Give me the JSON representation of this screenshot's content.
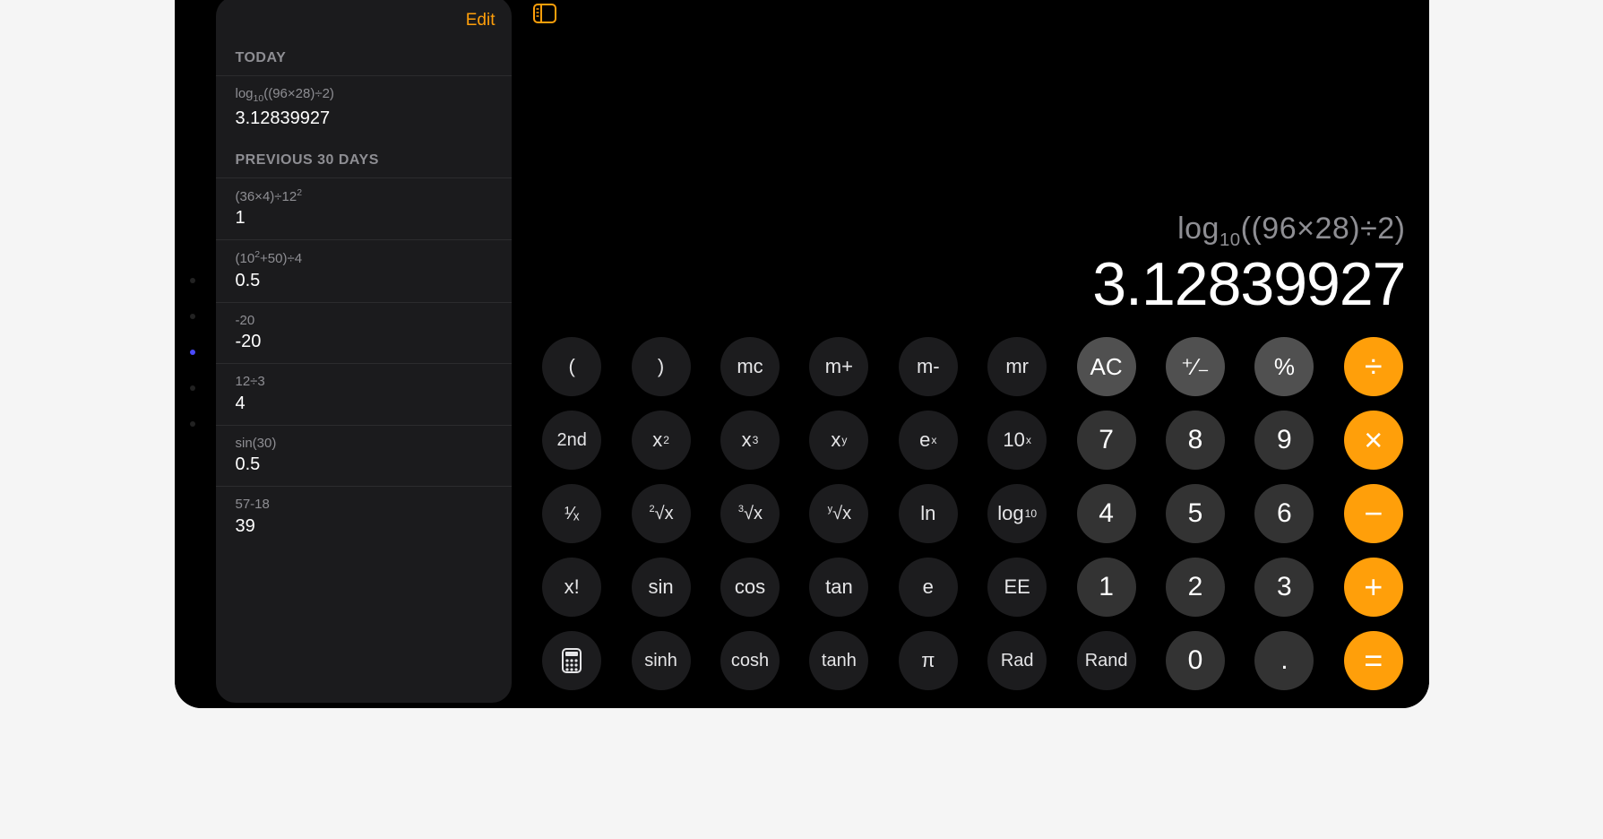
{
  "sidebar": {
    "edit_label": "Edit",
    "sections": [
      {
        "title": "TODAY",
        "items": [
          {
            "expr_html": "log<sub>10</sub>((96×28)÷2)",
            "result": "3.12839927"
          }
        ]
      },
      {
        "title": "PREVIOUS 30 DAYS",
        "items": [
          {
            "expr_html": "(36×4)÷12<sup>2</sup>",
            "result": "1"
          },
          {
            "expr_html": "(10<sup>2</sup>+50)÷4",
            "result": "0.5"
          },
          {
            "expr_html": "-20",
            "result": "-20"
          },
          {
            "expr_html": "12÷3",
            "result": "4"
          },
          {
            "expr_html": "sin(30)",
            "result": "0.5"
          },
          {
            "expr_html": "57-18",
            "result": "39"
          }
        ]
      }
    ]
  },
  "display": {
    "expression_html": "log<sub>10</sub>((96×28)÷2)",
    "result": "3.12839927"
  },
  "keys": {
    "row0": [
      {
        "name": "lparen",
        "cls": "dark",
        "html": "("
      },
      {
        "name": "rparen",
        "cls": "dark",
        "html": ")"
      },
      {
        "name": "mc",
        "cls": "dark",
        "html": "mc"
      },
      {
        "name": "mplus",
        "cls": "dark",
        "html": "m+"
      },
      {
        "name": "mminus",
        "cls": "dark",
        "html": "m-"
      },
      {
        "name": "mr",
        "cls": "dark",
        "html": "mr"
      },
      {
        "name": "ac",
        "cls": "gray",
        "html": "AC"
      },
      {
        "name": "negate",
        "cls": "gray",
        "html": "⁺∕₋"
      },
      {
        "name": "percent",
        "cls": "gray",
        "html": "%"
      },
      {
        "name": "divide",
        "cls": "op",
        "html": "÷"
      }
    ],
    "row1": [
      {
        "name": "second",
        "cls": "dark small",
        "html": "2nd"
      },
      {
        "name": "xsq",
        "cls": "dark",
        "html": "x<sup>2</sup>"
      },
      {
        "name": "xcb",
        "cls": "dark",
        "html": "x<sup>3</sup>"
      },
      {
        "name": "xy",
        "cls": "dark",
        "html": "x<sup>y</sup>"
      },
      {
        "name": "ex",
        "cls": "dark",
        "html": "e<sup>x</sup>"
      },
      {
        "name": "tenx",
        "cls": "dark",
        "html": "10<sup>x</sup>"
      },
      {
        "name": "seven",
        "cls": "num",
        "html": "7"
      },
      {
        "name": "eight",
        "cls": "num",
        "html": "8"
      },
      {
        "name": "nine",
        "cls": "num",
        "html": "9"
      },
      {
        "name": "multiply",
        "cls": "op",
        "html": "×"
      }
    ],
    "row2": [
      {
        "name": "recip",
        "cls": "dark",
        "html": "<span class='frac'>¹⁄ₓ</span>"
      },
      {
        "name": "sqrt",
        "cls": "dark",
        "html": "<span class='root'><sup>2</sup>√x</span>"
      },
      {
        "name": "cbrt",
        "cls": "dark",
        "html": "<span class='root'><sup>3</sup>√x</span>"
      },
      {
        "name": "yroot",
        "cls": "dark",
        "html": "<span class='root'><sup>y</sup>√x</span>"
      },
      {
        "name": "ln",
        "cls": "dark",
        "html": "ln"
      },
      {
        "name": "log10",
        "cls": "dark",
        "html": "log<sub>10</sub>"
      },
      {
        "name": "four",
        "cls": "num",
        "html": "4"
      },
      {
        "name": "five",
        "cls": "num",
        "html": "5"
      },
      {
        "name": "six",
        "cls": "num",
        "html": "6"
      },
      {
        "name": "minus",
        "cls": "op",
        "html": "−"
      }
    ],
    "row3": [
      {
        "name": "fact",
        "cls": "dark",
        "html": "x!"
      },
      {
        "name": "sin",
        "cls": "dark",
        "html": "sin"
      },
      {
        "name": "cos",
        "cls": "dark",
        "html": "cos"
      },
      {
        "name": "tan",
        "cls": "dark",
        "html": "tan"
      },
      {
        "name": "e",
        "cls": "dark",
        "html": "e"
      },
      {
        "name": "ee",
        "cls": "dark",
        "html": "EE"
      },
      {
        "name": "one",
        "cls": "num",
        "html": "1"
      },
      {
        "name": "two",
        "cls": "num",
        "html": "2"
      },
      {
        "name": "three",
        "cls": "num",
        "html": "3"
      },
      {
        "name": "plus",
        "cls": "op",
        "html": "+"
      }
    ],
    "row4": [
      {
        "name": "basic",
        "cls": "dark",
        "html": "__CALC_ICON__"
      },
      {
        "name": "sinh",
        "cls": "dark small",
        "html": "sinh"
      },
      {
        "name": "cosh",
        "cls": "dark small",
        "html": "cosh"
      },
      {
        "name": "tanh",
        "cls": "dark small",
        "html": "tanh"
      },
      {
        "name": "pi",
        "cls": "dark",
        "html": "π"
      },
      {
        "name": "rad",
        "cls": "dark small",
        "html": "Rad"
      },
      {
        "name": "rand",
        "cls": "dark small",
        "html": "Rand"
      },
      {
        "name": "zero",
        "cls": "num",
        "html": "0"
      },
      {
        "name": "dot",
        "cls": "num",
        "html": "."
      },
      {
        "name": "equals",
        "cls": "op",
        "html": "="
      }
    ]
  }
}
